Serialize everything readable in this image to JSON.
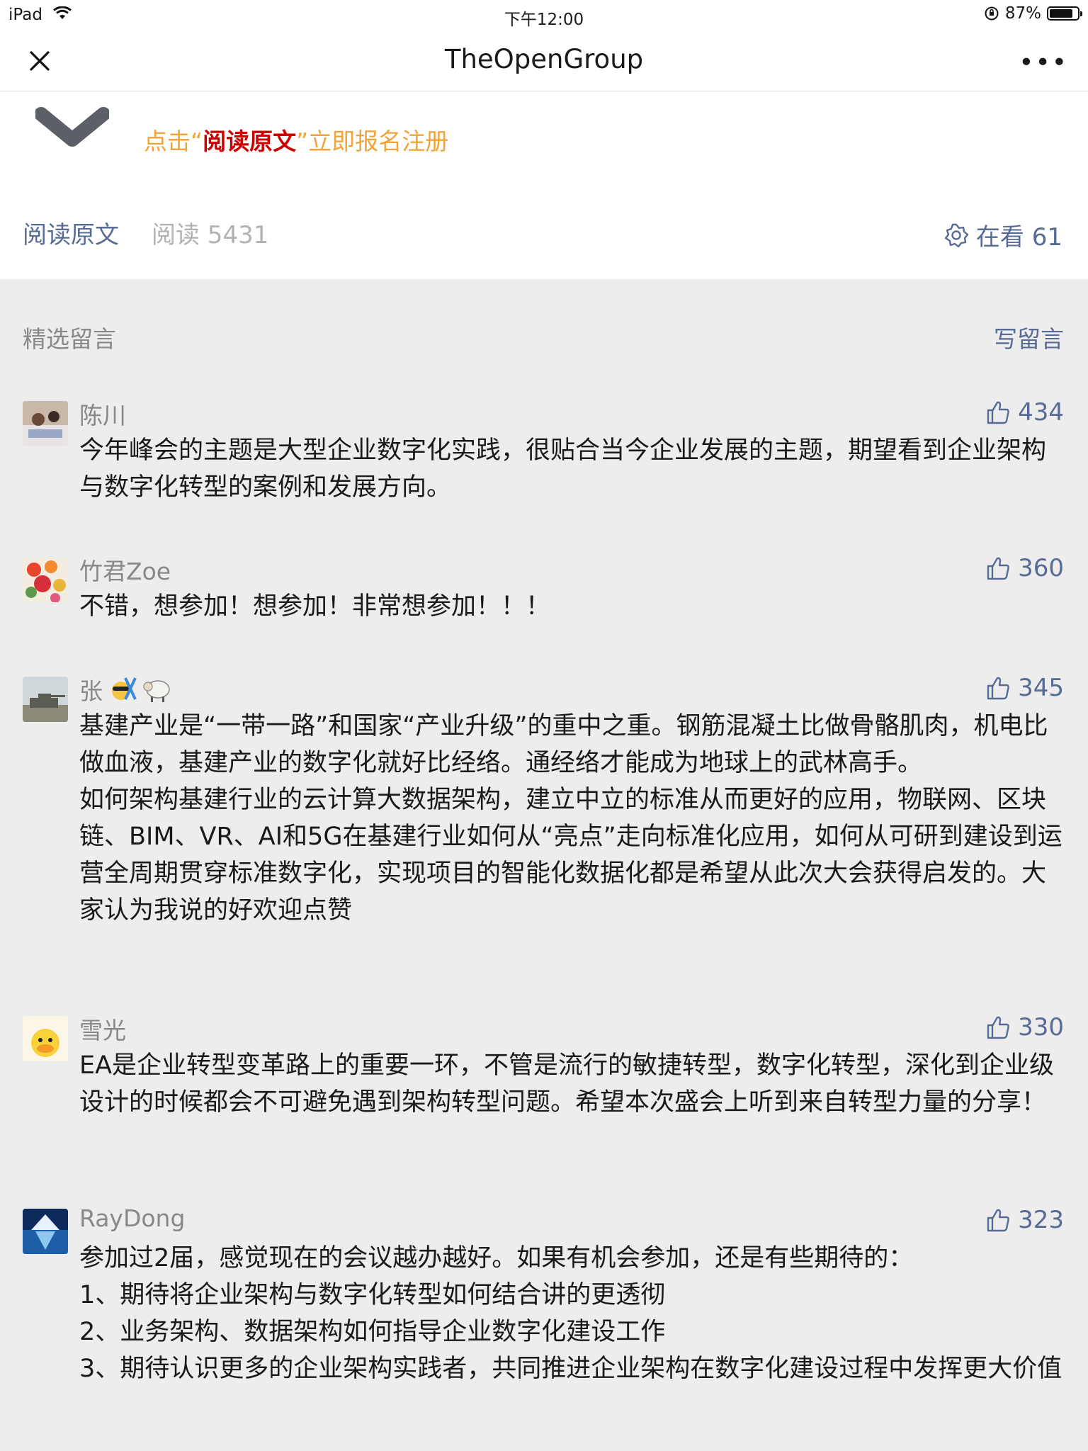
{
  "status": {
    "device": "iPad",
    "time": "下午12:00",
    "battery": "87%"
  },
  "nav": {
    "title": "TheOpenGroup"
  },
  "article": {
    "cta_prefix": "点击“",
    "cta_highlight": "阅读原文",
    "cta_suffix": "”立即报名注册",
    "read_original": "阅读原文",
    "read_count": "阅读 5431",
    "watching": "在看 61"
  },
  "comments": {
    "section_title": "精选留言",
    "write_label": "写留言",
    "items": [
      {
        "name": "陈川",
        "likes": "434",
        "text": "今年峰会的主题是大型企业数字化实践，很贴合当今企业发展的主题，期望看到企业架构与数字化转型的案例和发展方向。"
      },
      {
        "name": "竹君Zoe",
        "likes": "360",
        "text": "不错，想参加！想参加！非常想参加！！！"
      },
      {
        "name": "张",
        "likes": "345",
        "text": "基建产业是“一带一路”和国家“产业升级”的重中之重。钢筋混凝土比做骨骼肌肉，机电比做血液，基建产业的数字化就好比经络。通经络才能成为地球上的武林高手。\n如何架构基建行业的云计算大数据架构，建立中立的标准从而更好的应用，物联网、区块链、BIM、VR、AI和5G在基建行业如何从“亮点”走向标准化应用，如何从可研到建设到运营全周期贯穿标准数字化，实现项目的智能化数据化都是希望从此次大会获得启发的。大家认为我说的好欢迎点赞"
      },
      {
        "name": "雪光",
        "likes": "330",
        "text": "EA是企业转型变革路上的重要一环，不管是流行的敏捷转型，数字化转型，深化到企业级设计的时候都会不可避免遇到架构转型问题。希望本次盛会上听到来自转型力量的分享！"
      },
      {
        "name": "RayDong",
        "likes": "323",
        "text": "参加过2届，感觉现在的会议越办越好。如果有机会参加，还是有些期待的：\n1、期待将企业架构与数字化转型如何结合讲的更透彻\n2、业务架构、数据架构如何指导企业数字化建设工作\n3、期待认识更多的企业架构实践者，共同推进企业架构在数字化建设过程中发挥更大价值"
      }
    ]
  }
}
